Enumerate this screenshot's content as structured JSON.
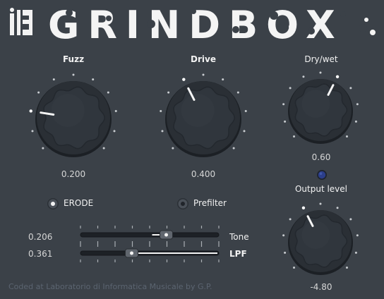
{
  "plugin": {
    "logo_mark": "I|3",
    "title": "GRINDBOX",
    "footer": "Coded at Laboratorio di Informatica Musicale by G.P."
  },
  "knobs": [
    {
      "id": "fuzz",
      "label": "Fuzz",
      "value": "0.200",
      "level": 0.2
    },
    {
      "id": "drive",
      "label": "Drive",
      "value": "0.400",
      "level": 0.4
    },
    {
      "id": "drywet",
      "label": "Dry/wet",
      "value": "0.60",
      "level": 0.6
    },
    {
      "id": "output",
      "label": "Output level",
      "value": "-4.80",
      "level": 0.4
    }
  ],
  "toggles": [
    {
      "id": "erode",
      "label": "ERODE",
      "on": true
    },
    {
      "id": "prefilter",
      "label": "Prefilter",
      "on": false
    }
  ],
  "sliders": [
    {
      "id": "tone",
      "label": "Tone",
      "value": "0.206",
      "level": 0.62
    },
    {
      "id": "lpf",
      "label": "LPF",
      "value": "0.361",
      "level": 0.37
    }
  ],
  "indicator": {
    "name": "status-led",
    "color": "#2b3e8a"
  },
  "colors": {
    "background": "#3b4148",
    "knob_body": "#2a2f35",
    "text": "#f2f2f2",
    "value_text": "#d6d6d6"
  }
}
